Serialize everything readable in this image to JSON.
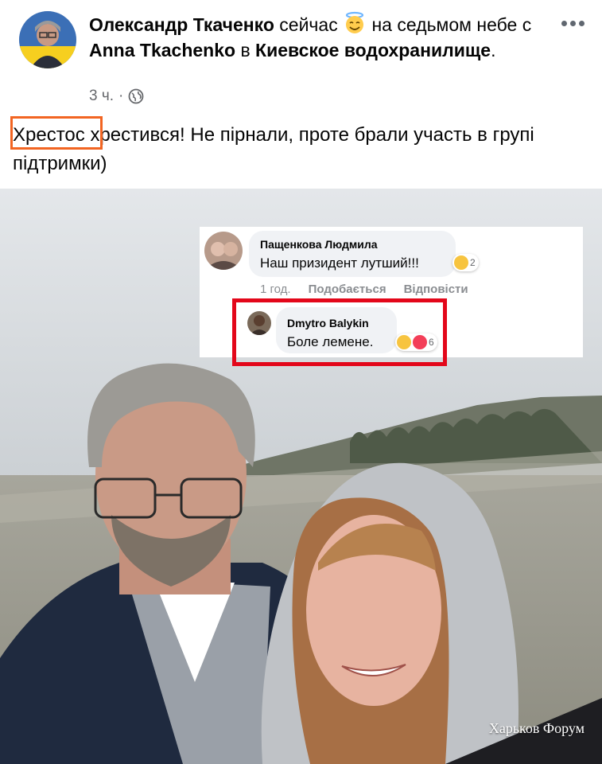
{
  "post": {
    "author": "Олександр Ткаченко",
    "time_word": "сейчас",
    "feeling": "на седьмом небе с",
    "tagged": "Anna Tkachenko",
    "in_word": "в",
    "place": "Киевское водохранилище",
    "period": ".",
    "timestamp": "3 ч.",
    "separator": "·",
    "privacy_icon": "globe-icon",
    "more_icon": "more-options-icon",
    "text_highlight": "Хрестос",
    "text_rest": " хрестився! Не пірнали, проте брали участь в групі підтримки)"
  },
  "comments": {
    "first": {
      "name": "Пащенкова Людмила",
      "text": "Наш призидент лутший!!!",
      "reaction_count": "2",
      "time": "1 год.",
      "like": "Подобається",
      "reply": "Відповісти"
    },
    "reply": {
      "name": "Dmytro Balykin",
      "text": "Боле лемене.",
      "reaction_count": "6"
    }
  },
  "watermark": "Харьков Форум",
  "colors": {
    "highlight_orange": "#f26522",
    "highlight_red": "#e3071a",
    "meta_gray": "#65676b"
  }
}
